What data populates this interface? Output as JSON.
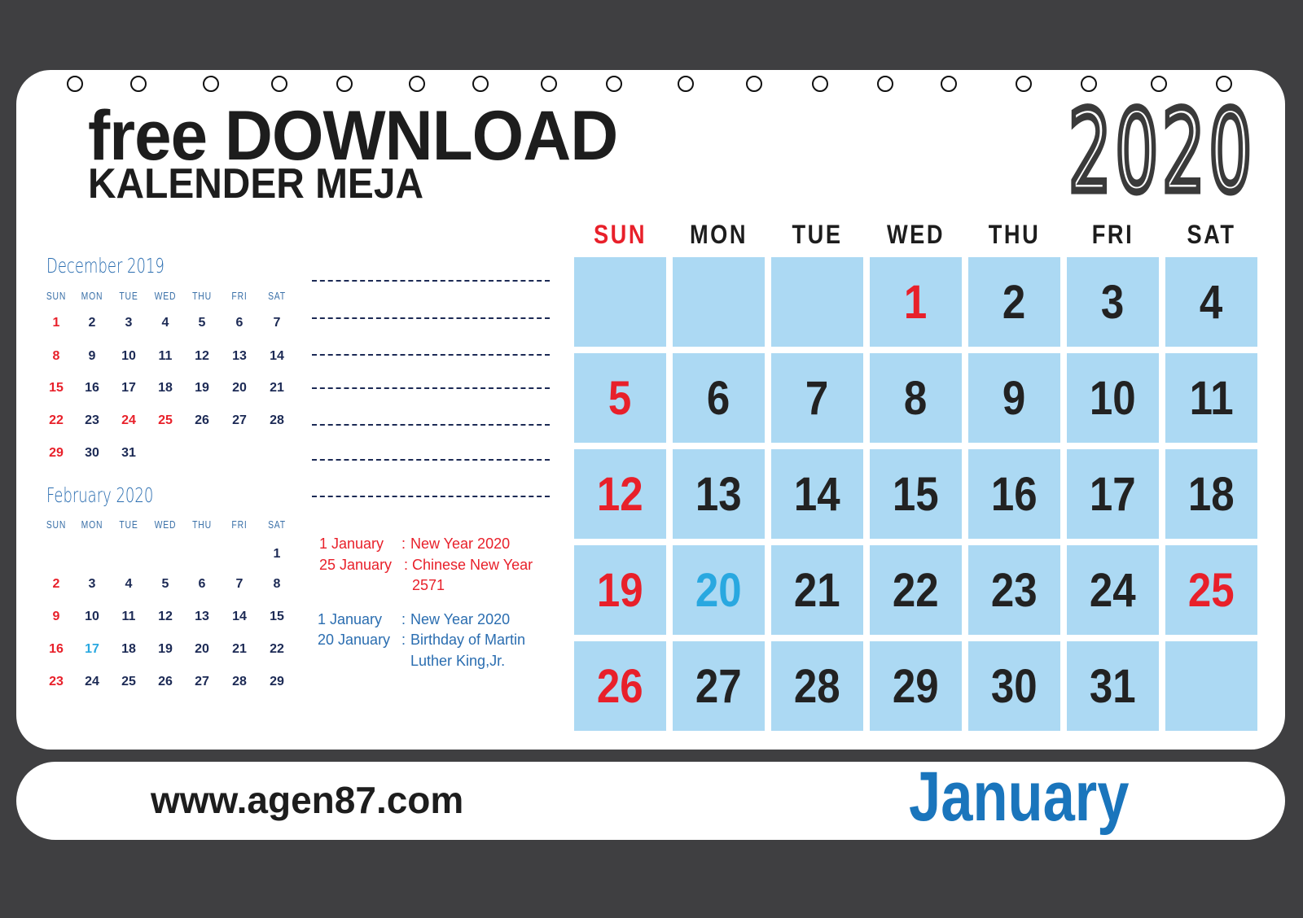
{
  "title": {
    "line1": "free DOWNLOAD",
    "line2": "KALENDER MEJA"
  },
  "year": "2020",
  "colors": {
    "background": "#3f3f41",
    "cell": "#acd9f3",
    "red": "#e8202a",
    "blue": "#2a6db0",
    "cyan": "#29a8e0",
    "month": "#1a75bc"
  },
  "main_calendar": {
    "weekdays": [
      "SUN",
      "MON",
      "TUE",
      "WED",
      "THU",
      "FRI",
      "SAT"
    ],
    "weeks": [
      [
        null,
        null,
        null,
        1,
        2,
        3,
        4
      ],
      [
        5,
        6,
        7,
        8,
        9,
        10,
        11
      ],
      [
        12,
        13,
        14,
        15,
        16,
        17,
        18
      ],
      [
        19,
        20,
        21,
        22,
        23,
        24,
        25
      ],
      [
        26,
        27,
        28,
        29,
        30,
        31,
        null
      ]
    ],
    "red_days": [
      1,
      5,
      12,
      19,
      25,
      26
    ],
    "blue_days": [
      20
    ]
  },
  "mini_calendars": [
    {
      "title": "December 2019",
      "weekdays": [
        "SUN",
        "MON",
        "TUE",
        "WED",
        "THU",
        "FRI",
        "SAT"
      ],
      "weeks": [
        [
          1,
          2,
          3,
          4,
          5,
          6,
          7
        ],
        [
          8,
          9,
          10,
          11,
          12,
          13,
          14
        ],
        [
          15,
          16,
          17,
          18,
          19,
          20,
          21
        ],
        [
          22,
          23,
          24,
          25,
          26,
          27,
          28
        ],
        [
          29,
          30,
          31,
          null,
          null,
          null,
          null
        ]
      ],
      "red_days": [
        1,
        8,
        15,
        22,
        24,
        25,
        29
      ],
      "blue_days": []
    },
    {
      "title": "February 2020",
      "weekdays": [
        "SUN",
        "MON",
        "TUE",
        "WED",
        "THU",
        "FRI",
        "SAT"
      ],
      "weeks": [
        [
          null,
          null,
          null,
          null,
          null,
          null,
          1
        ],
        [
          2,
          3,
          4,
          5,
          6,
          7,
          8
        ],
        [
          9,
          10,
          11,
          12,
          13,
          14,
          15
        ],
        [
          16,
          17,
          18,
          19,
          20,
          21,
          22
        ],
        [
          23,
          24,
          25,
          26,
          27,
          28,
          29
        ]
      ],
      "red_days": [
        2,
        9,
        16,
        23
      ],
      "blue_days": [
        17
      ]
    }
  ],
  "holidays_red": [
    {
      "date": "1   January",
      "sep": ":",
      "text": "New Year 2020"
    },
    {
      "date": "25 January",
      "sep": ":",
      "text": "Chinese New Year",
      "text2": "2571"
    }
  ],
  "holidays_blue": [
    {
      "date": "1   January",
      "sep": ":",
      "text": "New Year 2020"
    },
    {
      "date": "20 January",
      "sep": ":",
      "text": "Birthday of Martin",
      "text2": "Luther King,Jr."
    }
  ],
  "footer": {
    "url": "www.agen87.com",
    "month": "January"
  }
}
